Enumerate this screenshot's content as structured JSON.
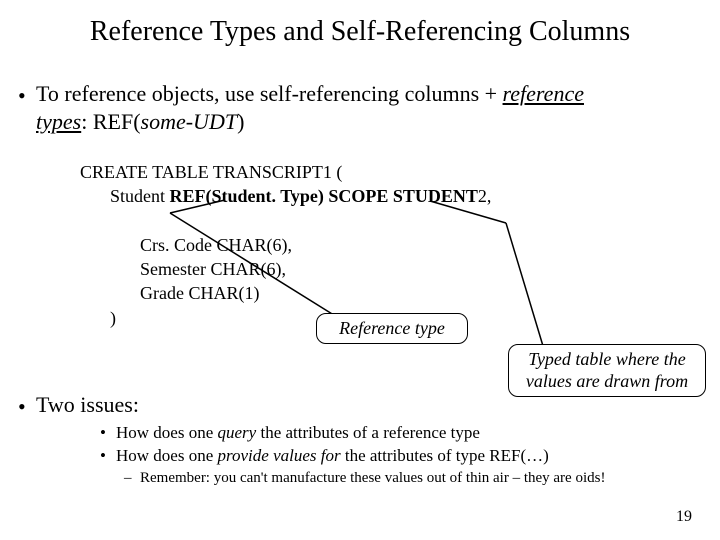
{
  "title": "Reference Types and Self-Referencing Columns",
  "b1": {
    "seg1": "To reference objects, use self-referencing columns + ",
    "ref_word": "reference",
    "types_word": "types",
    "colon": ": ",
    "ref_kw": "REF",
    "lp": "(",
    "some_udt": "some-UDT",
    "rp": ")"
  },
  "code": {
    "l1a": "CREATE  TABLE  TRANSCRIPT",
    "l1b": "1",
    "l1c": " (",
    "l2a": "Student  ",
    "l2b": "REF(Student. Type)  SCOPE  STUDENT",
    "l2c": "2",
    "l2d": ",",
    "l3": "",
    "l4": "Crs. Code  CHAR(6),",
    "l5": "Semester  CHAR(6),",
    "l6": "Grade  CHAR(1)",
    "l7": ")"
  },
  "callouts": {
    "ref": "Reference type",
    "typed_l1": "Typed table where the",
    "typed_l2": "values are drawn from"
  },
  "two_issues": "Two issues:",
  "sub": {
    "q1a": "How does one ",
    "q1b": "query",
    "q1c": " the attributes of a reference type",
    "p1a": "How does one ",
    "p1b": "provide values for",
    "p1c": " the attributes of type REF(…)",
    "dash": "Remember: you can't manufacture these values out of thin air – they are oids!"
  },
  "page": "19"
}
